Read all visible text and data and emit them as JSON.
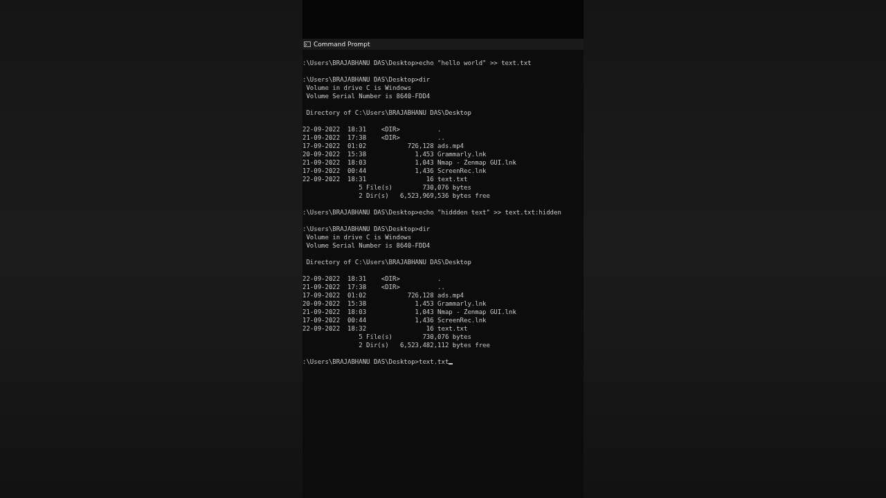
{
  "window": {
    "title": "Command Prompt"
  },
  "console": {
    "blocks": [
      [
        ":\\Users\\BRAJABHANU DAS\\Desktop>echo \"hello world\" >> text.txt"
      ],
      [
        ":\\Users\\BRAJABHANU DAS\\Desktop>dir",
        " Volume in drive C is Windows",
        " Volume Serial Number is 8640-FDD4"
      ],
      [
        " Directory of C:\\Users\\BRAJABHANU DAS\\Desktop"
      ],
      [
        "22-09-2022  18:31    <DIR>          .",
        "21-09-2022  17:38    <DIR>          ..",
        "17-09-2022  01:02           726,128 ads.mp4",
        "20-09-2022  15:38             1,453 Grammarly.lnk",
        "21-09-2022  18:03             1,043 Nmap - Zenmap GUI.lnk",
        "17-09-2022  00:44             1,436 ScreenRec.lnk",
        "22-09-2022  18:31                16 text.txt",
        "               5 File(s)        730,076 bytes",
        "               2 Dir(s)   6,523,969,536 bytes free"
      ],
      [
        ":\\Users\\BRAJABHANU DAS\\Desktop>echo \"hiddden text\" >> text.txt:hidden"
      ],
      [
        ":\\Users\\BRAJABHANU DAS\\Desktop>dir",
        " Volume in drive C is Windows",
        " Volume Serial Number is 8640-FDD4"
      ],
      [
        " Directory of C:\\Users\\BRAJABHANU DAS\\Desktop"
      ],
      [
        "22-09-2022  18:31    <DIR>          .",
        "21-09-2022  17:38    <DIR>          ..",
        "17-09-2022  01:02           726,128 ads.mp4",
        "20-09-2022  15:38             1,453 Grammarly.lnk",
        "21-09-2022  18:03             1,043 Nmap - Zenmap GUI.lnk",
        "17-09-2022  00:44             1,436 ScreenRec.lnk",
        "22-09-2022  18:32                16 text.txt",
        "               5 File(s)        730,076 bytes",
        "               2 Dir(s)   6,523,482,112 bytes free"
      ],
      [
        ":\\Users\\BRAJABHANU DAS\\Desktop>text.txt"
      ]
    ]
  }
}
